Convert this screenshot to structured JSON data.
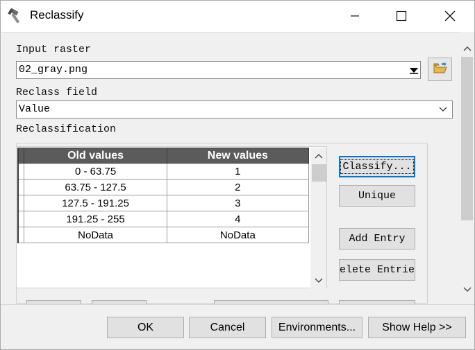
{
  "window": {
    "title": "Reclassify",
    "controls": {
      "minimize": "—",
      "maximize": "☐",
      "close": "✕"
    }
  },
  "form": {
    "input_raster_label": "Input raster",
    "input_raster_value": "02_gray.png",
    "reclass_field_label": "Reclass field",
    "reclass_field_value": "Value",
    "reclassification_label": "Reclassification"
  },
  "table": {
    "columns": [
      "Old values",
      "New values"
    ],
    "rows": [
      {
        "old": "0 - 63.75",
        "new": "1"
      },
      {
        "old": "63.75 - 127.5",
        "new": "2"
      },
      {
        "old": "127.5 - 191.25",
        "new": "3"
      },
      {
        "old": "191.25 - 255",
        "new": "4"
      },
      {
        "old": "NoData",
        "new": "NoData"
      }
    ]
  },
  "side_buttons": {
    "classify": "Classify...",
    "unique": "Unique",
    "add_entry": "Add Entry",
    "delete_entries": "elete Entrie"
  },
  "footer": {
    "ok": "OK",
    "cancel": "Cancel",
    "environments": "Environments...",
    "show_help": "Show Help >>"
  },
  "icons": {
    "app": "hammer-icon",
    "browse": "open-folder-icon",
    "dropdown": "chevron-down-icon"
  },
  "colors": {
    "table_header_bg": "#5b5b5b",
    "focus_border": "#0078d7",
    "button_bg": "#e1e1e1",
    "panel_bg": "#f0f0f0"
  }
}
